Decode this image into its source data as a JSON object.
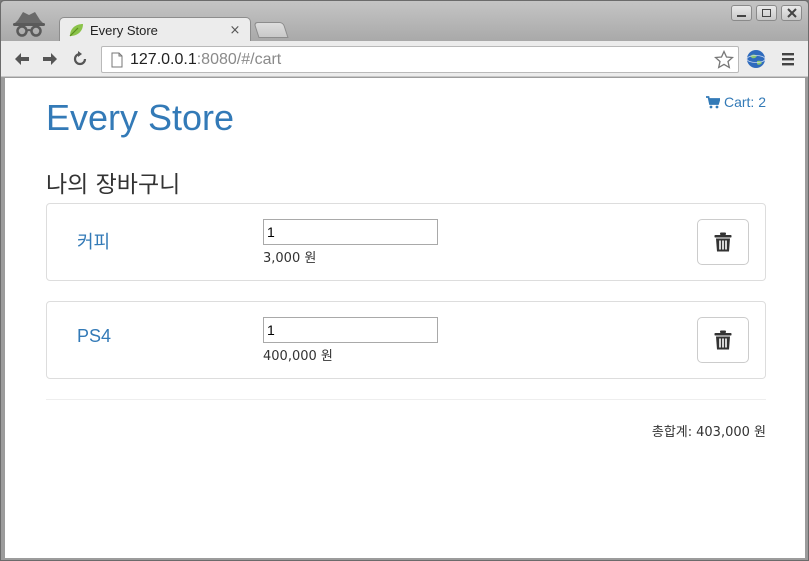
{
  "browser": {
    "tab_title": "Every Store",
    "tab_close": "×",
    "url_host": "127.0.0.1",
    "url_rest": ":8080/#/cart",
    "icons": {
      "incognito": "incognito-icon",
      "favicon": "leaf-icon",
      "back": "back-arrow-icon",
      "forward": "forward-arrow-icon",
      "reload": "reload-icon",
      "page": "page-icon",
      "star": "star-icon",
      "extension": "globe-icon",
      "menu": "hamburger-menu-icon"
    }
  },
  "header": {
    "brand": "Every Store",
    "cart_link": "Cart: 2",
    "cart_icon": "shopping-cart-icon"
  },
  "cart": {
    "title": "나의 장바구니",
    "items": [
      {
        "name": "커피",
        "quantity": "1",
        "price": "3,000 원"
      },
      {
        "name": "PS4",
        "quantity": "1",
        "price": "400,000 원"
      }
    ],
    "delete_icon": "trash-icon",
    "total_label": "총합계:",
    "total_value": "403,000 원"
  },
  "colors": {
    "link": "#337ab7",
    "text": "#333333",
    "panel_border": "#dddddd"
  }
}
